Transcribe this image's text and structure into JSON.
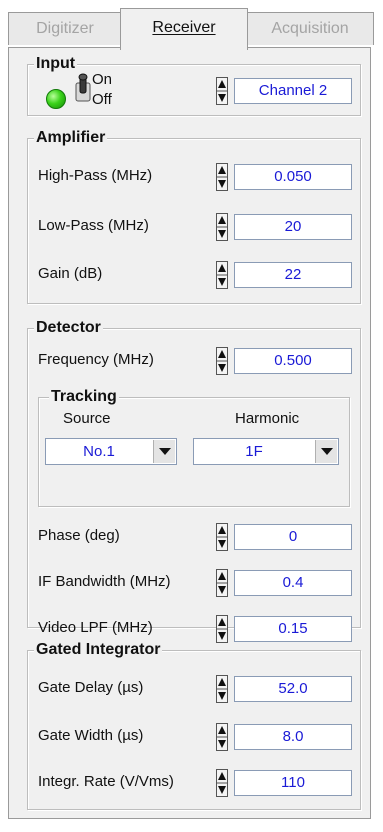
{
  "tabs": [
    {
      "label": "Digitizer",
      "active": false
    },
    {
      "label": "Receiver",
      "active": true
    },
    {
      "label": "Acquisition",
      "active": false
    }
  ],
  "colors": {
    "field_text": "#1a1ad6",
    "led": "#3ad21a",
    "panel": "#f0f0f0"
  },
  "input": {
    "title": "Input",
    "led_state": "on",
    "switch_on_label": "On",
    "switch_off_label": "Off",
    "channel": "Channel 2"
  },
  "amplifier": {
    "title": "Amplifier",
    "rows": [
      {
        "label": "High-Pass (MHz)",
        "value": "0.050"
      },
      {
        "label": "Low-Pass (MHz)",
        "value": "20"
      },
      {
        "label": "Gain (dB)",
        "value": "22"
      }
    ]
  },
  "detector": {
    "title": "Detector",
    "frequency": {
      "label": "Frequency (MHz)",
      "value": "0.500"
    },
    "tracking": {
      "title": "Tracking",
      "source_label": "Source",
      "source_value": "No.1",
      "harmonic_label": "Harmonic",
      "harmonic_value": "1F"
    },
    "rows": [
      {
        "label": "Phase (deg)",
        "value": "0"
      },
      {
        "label": "IF Bandwidth (MHz)",
        "value": "0.4"
      },
      {
        "label": "Video LPF (MHz)",
        "value": "0.15"
      }
    ]
  },
  "gated": {
    "title": "Gated Integrator",
    "rows": [
      {
        "label": "Gate Delay (µs)",
        "value": "52.0"
      },
      {
        "label": "Gate Width (µs)",
        "value": "8.0"
      },
      {
        "label": "Integr. Rate (V/Vms)",
        "value": "110"
      }
    ]
  }
}
